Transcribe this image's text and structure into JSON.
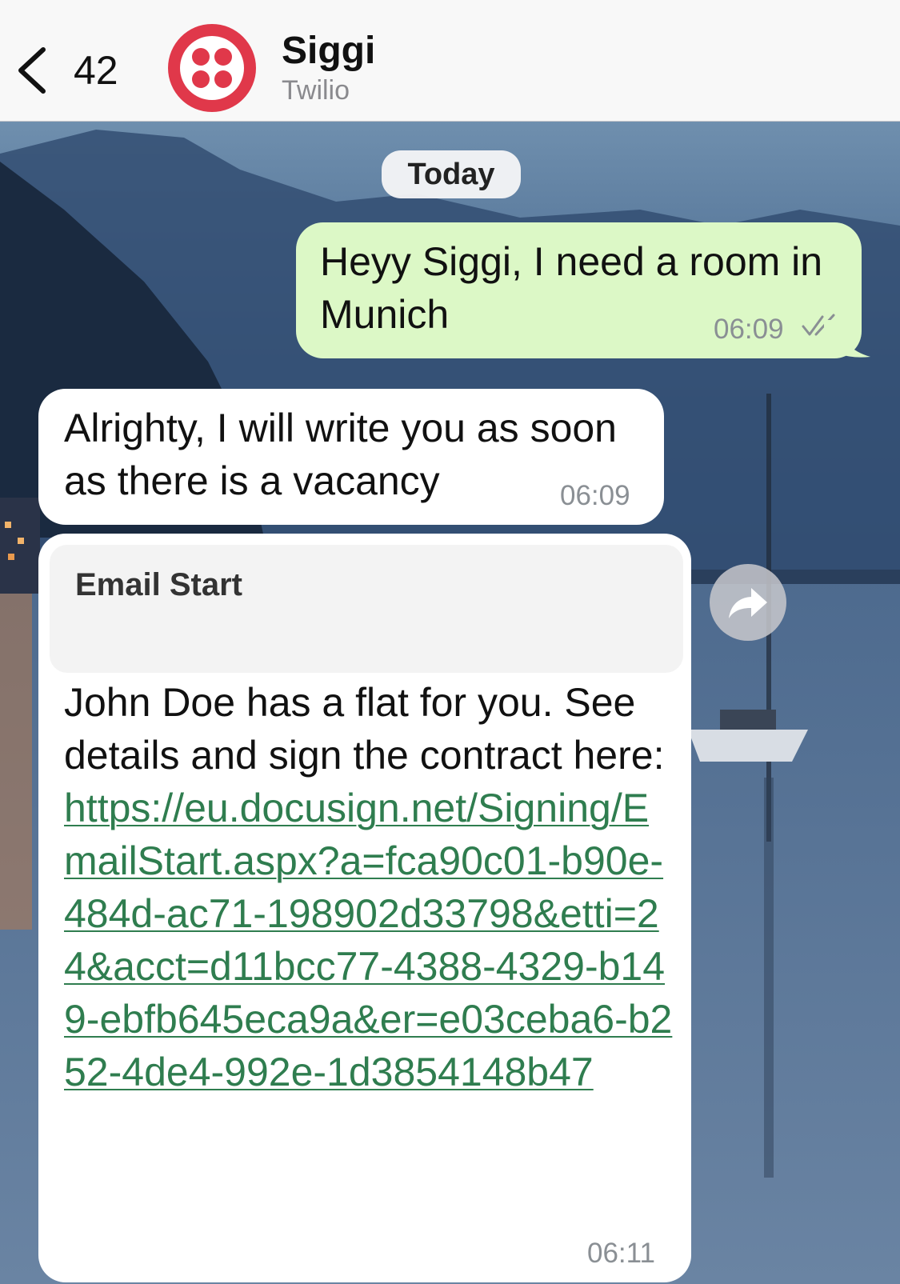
{
  "header": {
    "back_count": "42",
    "contact_name": "Siggi",
    "contact_subtitle": "Twilio",
    "avatar_color": "#e0384a"
  },
  "chat": {
    "date_label": "Today",
    "messages": [
      {
        "direction": "outgoing",
        "text": "Heyy Siggi, I need a room in Munich",
        "time": "06:09",
        "status": "read-double-check"
      },
      {
        "direction": "incoming",
        "text": "Alrighty, I will write you as soon as there is a vacancy",
        "time": "06:09"
      },
      {
        "direction": "incoming",
        "card_title": "Email Start",
        "text_prefix": "John Doe has a flat for you. See details and sign the contract here: ",
        "link": "https://eu.docusign.net/Signing/EmailStart.aspx?a=fca90c01-b90e-484d-ac71-198902d33798&etti=24&acct=d11bcc77-4388-4329-b149-ebfb645eca9a&er=e03ceba6-b252-4de4-992e-1d3854148b47",
        "time": "06:11"
      }
    ]
  },
  "colors": {
    "outgoing_bubble": "#dcf8c6",
    "incoming_bubble": "#ffffff",
    "link": "#2f7d4f"
  },
  "icons": {
    "back": "chevron-left-icon",
    "status": "double-check-icon",
    "forward": "forward-icon",
    "avatar": "twilio-logo-icon"
  }
}
